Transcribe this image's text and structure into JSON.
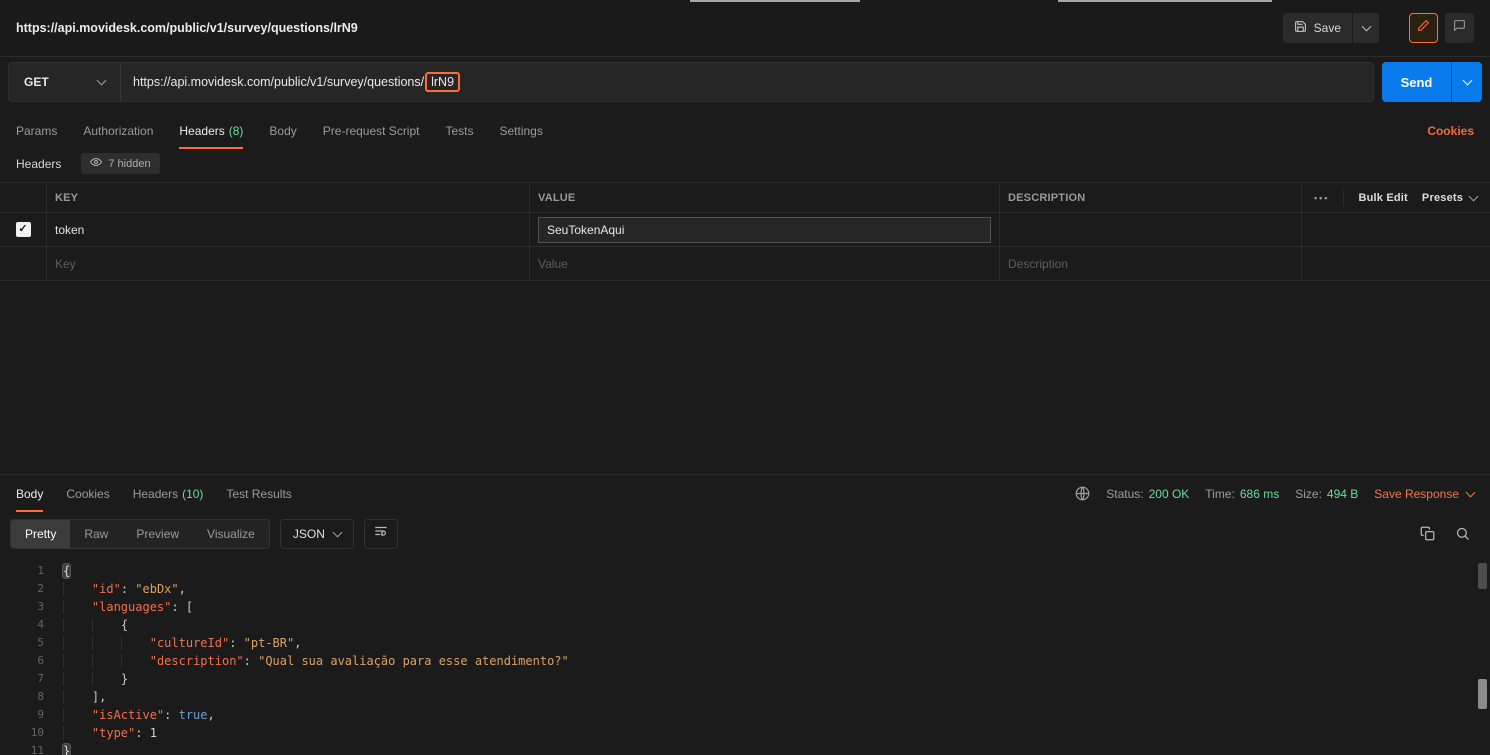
{
  "colors": {
    "accent": "#ff6c37",
    "send_blue": "#097bed",
    "success_green": "#6bdd9a"
  },
  "icons": {
    "more_options": "•••"
  },
  "topbar": {
    "tab_title": "https://api.movidesk.com/public/v1/survey/questions/lrN9",
    "save_label": "Save"
  },
  "request": {
    "method": "GET",
    "url_prefix": "https://api.movidesk.com/public/v1/survey/questions/",
    "url_highlighted": "lrN9",
    "send_label": "Send",
    "cookies_link": "Cookies",
    "tabs": [
      {
        "label": "Params"
      },
      {
        "label": "Authorization"
      },
      {
        "label": "Headers",
        "count": "(8)"
      },
      {
        "label": "Body"
      },
      {
        "label": "Pre-request Script"
      },
      {
        "label": "Tests"
      },
      {
        "label": "Settings"
      }
    ]
  },
  "headers_editor": {
    "section_title": "Headers",
    "hidden_badge": "7 hidden",
    "columns": {
      "key": "KEY",
      "value": "VALUE",
      "description": "DESCRIPTION"
    },
    "bulk_edit_label": "Bulk Edit",
    "presets_label": "Presets",
    "row": {
      "key": "token",
      "value": "SeuTokenAqui",
      "description": ""
    },
    "placeholders": {
      "key": "Key",
      "value": "Value",
      "description": "Description"
    }
  },
  "response": {
    "tabs": [
      {
        "label": "Body"
      },
      {
        "label": "Cookies"
      },
      {
        "label": "Headers",
        "count": "(10)"
      },
      {
        "label": "Test Results"
      }
    ],
    "status_label": "Status:",
    "status_value": "200 OK",
    "time_label": "Time:",
    "time_value": "686 ms",
    "size_label": "Size:",
    "size_value": "494 B",
    "save_response_label": "Save Response",
    "view_tabs": [
      "Pretty",
      "Raw",
      "Preview",
      "Visualize"
    ],
    "format_select": "JSON"
  },
  "code": {
    "lines": [
      {
        "n": 1,
        "indent": 0,
        "tokens": [
          {
            "c": "ph",
            "t": "{"
          }
        ]
      },
      {
        "n": 2,
        "indent": 1,
        "tokens": [
          {
            "c": "k",
            "t": "\"id\""
          },
          {
            "c": "p",
            "t": ": "
          },
          {
            "c": "s",
            "t": "\"ebDx\""
          },
          {
            "c": "p",
            "t": ","
          }
        ]
      },
      {
        "n": 3,
        "indent": 1,
        "tokens": [
          {
            "c": "k",
            "t": "\"languages\""
          },
          {
            "c": "p",
            "t": ": ["
          }
        ]
      },
      {
        "n": 4,
        "indent": 2,
        "tokens": [
          {
            "c": "p",
            "t": "{"
          }
        ]
      },
      {
        "n": 5,
        "indent": 3,
        "tokens": [
          {
            "c": "k",
            "t": "\"cultureId\""
          },
          {
            "c": "p",
            "t": ": "
          },
          {
            "c": "s",
            "t": "\"pt-BR\""
          },
          {
            "c": "p",
            "t": ","
          }
        ]
      },
      {
        "n": 6,
        "indent": 3,
        "tokens": [
          {
            "c": "k",
            "t": "\"description\""
          },
          {
            "c": "p",
            "t": ": "
          },
          {
            "c": "s",
            "t": "\"Qual sua avaliação para esse atendimento?\""
          }
        ]
      },
      {
        "n": 7,
        "indent": 2,
        "tokens": [
          {
            "c": "p",
            "t": "}"
          }
        ]
      },
      {
        "n": 8,
        "indent": 1,
        "tokens": [
          {
            "c": "p",
            "t": "],"
          }
        ]
      },
      {
        "n": 9,
        "indent": 1,
        "tokens": [
          {
            "c": "k",
            "t": "\"isActive\""
          },
          {
            "c": "p",
            "t": ": "
          },
          {
            "c": "b",
            "t": "true"
          },
          {
            "c": "p",
            "t": ","
          }
        ]
      },
      {
        "n": 10,
        "indent": 1,
        "tokens": [
          {
            "c": "k",
            "t": "\"type\""
          },
          {
            "c": "p",
            "t": ": "
          },
          {
            "c": "n",
            "t": "1"
          }
        ]
      },
      {
        "n": 11,
        "indent": 0,
        "tokens": [
          {
            "c": "ph",
            "t": "}"
          }
        ]
      }
    ]
  }
}
